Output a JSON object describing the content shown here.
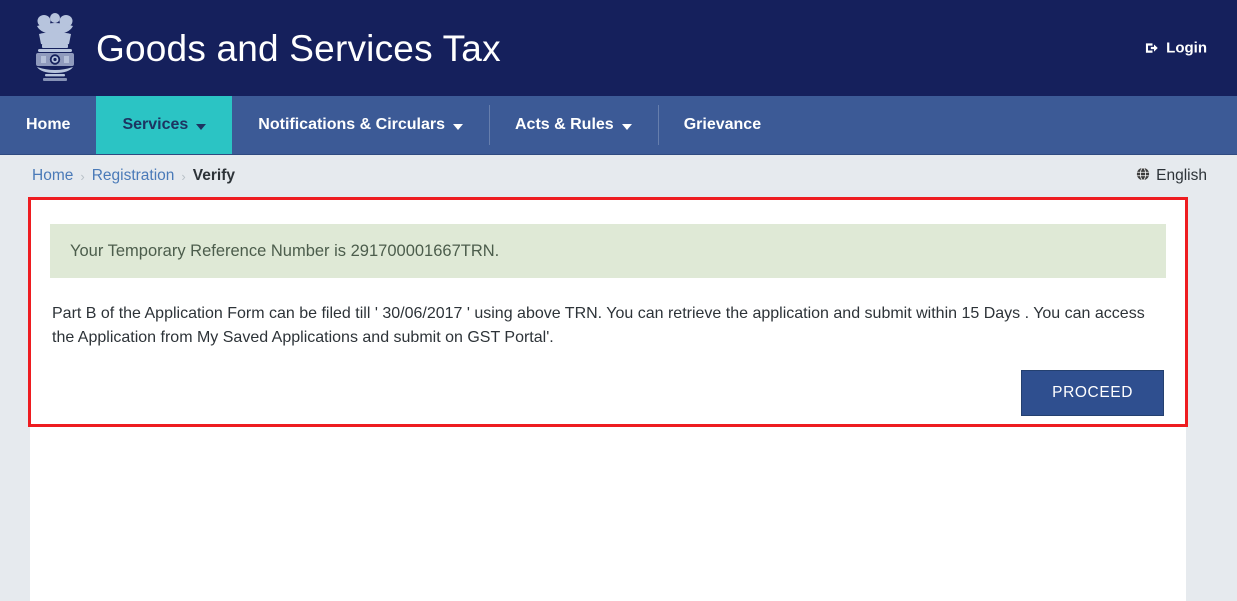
{
  "header": {
    "title": "Goods and Services Tax",
    "emblem_icon": "india-national-emblem",
    "login_label": "Login",
    "login_icon": "sign-in-icon",
    "bg_color": "#15205c"
  },
  "nav": {
    "bg_color": "#3c5a96",
    "active_color": "#2bc4c4",
    "items": [
      {
        "label": "Home",
        "has_caret": false,
        "active": false
      },
      {
        "label": "Services",
        "has_caret": true,
        "active": true
      },
      {
        "label": "Notifications & Circulars",
        "has_caret": true,
        "active": false
      },
      {
        "label": "Acts & Rules",
        "has_caret": true,
        "active": false
      },
      {
        "label": "Grievance",
        "has_caret": false,
        "active": false
      }
    ]
  },
  "breadcrumb": {
    "items": [
      {
        "label": "Home",
        "current": false
      },
      {
        "label": "Registration",
        "current": false
      },
      {
        "label": "Verify",
        "current": true
      }
    ],
    "separator": "›"
  },
  "language": {
    "label": "English",
    "icon": "globe-icon"
  },
  "main": {
    "alert": {
      "text": "Your Temporary Reference Number is 291700001667TRN.",
      "trn": "291700001667TRN",
      "bg_color": "#dfe9d6",
      "text_color": "#4c5d4c"
    },
    "message": "Part B of the Application Form can be filed till ' 30/06/2017 ' using above TRN. You can retrieve the application and submit within 15 Days . You can access the Application from My Saved Applications and submit on GST Portal'.",
    "message_due_date": "30/06/2017",
    "message_days": "15 Days",
    "proceed_label": "PROCEED",
    "proceed_color": "#2f4f8f"
  },
  "annotation": {
    "highlight_color": "#ee1c20"
  }
}
